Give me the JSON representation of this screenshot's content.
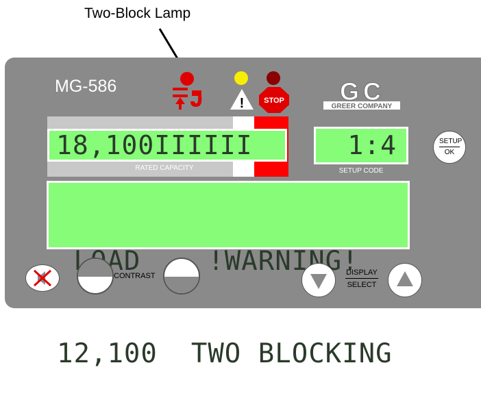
{
  "callout": {
    "label": "Two-Block Lamp"
  },
  "panel": {
    "model": "MG-586",
    "logo_top": "GC",
    "logo_bottom": "GREER COMPANY",
    "stop_label": "STOP",
    "warning_symbol": "!",
    "rated_capacity": {
      "value": "18,100",
      "bar": "IIIIII",
      "label": "RATED CAPACITY"
    },
    "setup_code": {
      "value": "1:4",
      "label": "SETUP CODE"
    },
    "setup_button": {
      "top": "SETUP",
      "bottom": "OK"
    },
    "main_display": {
      "line1": " LOAD    !WARNING!",
      "line2": "12,100  TWO BLOCKING"
    },
    "contrast_label": "CONTRAST",
    "display_select": {
      "top": "DISPLAY",
      "bottom": "SELECT"
    }
  },
  "colors": {
    "lcd": "#86fc78",
    "panel": "#8a8a8a",
    "alarm_red": "#e10000",
    "warning_yellow": "#f7ee00"
  },
  "icons": [
    "arrow-icon",
    "anti-two-block-icon",
    "warning-triangle-icon",
    "stop-sign-icon",
    "greer-logo",
    "mute-icon",
    "up-triangle-icon",
    "down-triangle-icon"
  ]
}
